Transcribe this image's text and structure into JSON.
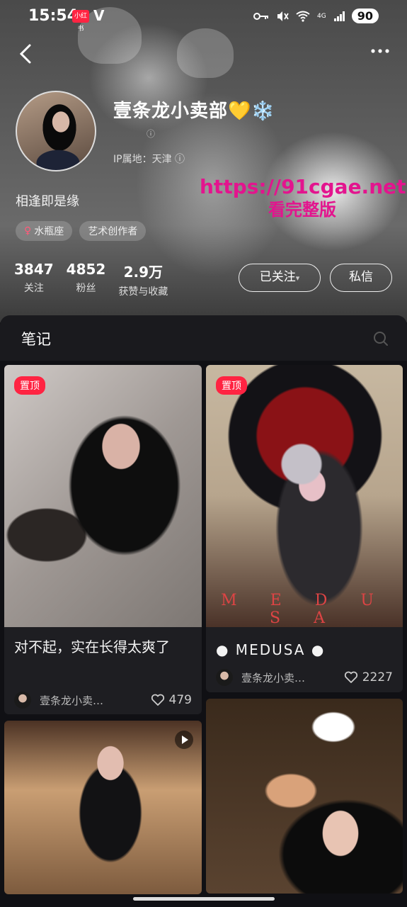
{
  "status_bar": {
    "time": "15:54",
    "badge": "小红书",
    "v": "V",
    "network": "4G",
    "battery": "90"
  },
  "profile": {
    "name": "壹条龙小卖部💛❄️",
    "verify_hint": "ⓘ",
    "ip": "IP属地：天津 ⓘ",
    "bio": "相逢即是缘",
    "tags": [
      {
        "icon": "♀",
        "label": "水瓶座"
      },
      {
        "icon": "",
        "label": "艺术创作者"
      }
    ],
    "stats": [
      {
        "value": "3847",
        "label": "关注"
      },
      {
        "value": "4852",
        "label": "粉丝"
      },
      {
        "value": "2.9万",
        "label": "获赞与收藏"
      }
    ],
    "follow_label": "已关注",
    "follow_caret": "▾",
    "message_label": "私信"
  },
  "watermark": {
    "line1": "https://91cgae.net",
    "line2": "看完整版"
  },
  "notes": {
    "title": "笔记"
  },
  "cards": [
    {
      "pinned": "置顶",
      "title": "对不起，实在长得太爽了",
      "author": "壹条龙小卖…",
      "likes": "479"
    },
    {
      "pinned": "置顶",
      "overlay": "M E D U S A",
      "title": "● MEDUSA ●",
      "author": "壹条龙小卖…",
      "likes": "2227"
    },
    {
      "video": true
    },
    {}
  ],
  "colors": {
    "accent": "#ff2442",
    "watermark": "#e3148e",
    "background": "#101014"
  }
}
